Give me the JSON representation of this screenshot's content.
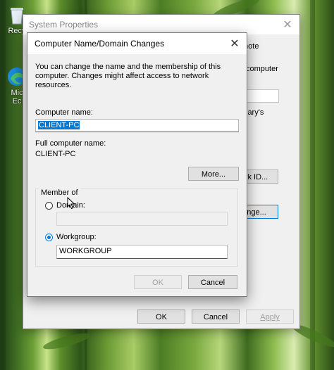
{
  "desktop": {
    "icons": [
      {
        "label": "Recy"
      },
      {
        "label": "Mic\nEc"
      }
    ]
  },
  "system_properties": {
    "title": "System Properties",
    "tab_fragment": "mote",
    "peek_text_1": "computer",
    "peek_text_2": "lary's",
    "network_id_fragment": "rk ID...",
    "change_fragment": "nge...",
    "ok_label": "OK",
    "cancel_label": "Cancel",
    "apply_label": "Apply"
  },
  "dialog": {
    "title": "Computer Name/Domain Changes",
    "description": "You can change the name and the membership of this computer. Changes might affect access to network resources.",
    "computer_name_label": "Computer name:",
    "computer_name_value": "CLIENT-PC",
    "full_name_label": "Full computer name:",
    "full_name_value": "CLIENT-PC",
    "more_label": "More...",
    "member_of_label": "Member of",
    "domain_label": "Domain:",
    "domain_value": "",
    "workgroup_label": "Workgroup:",
    "workgroup_value": "WORKGROUP",
    "selected_membership": "Workgroup",
    "ok_label": "OK",
    "cancel_label": "Cancel"
  }
}
